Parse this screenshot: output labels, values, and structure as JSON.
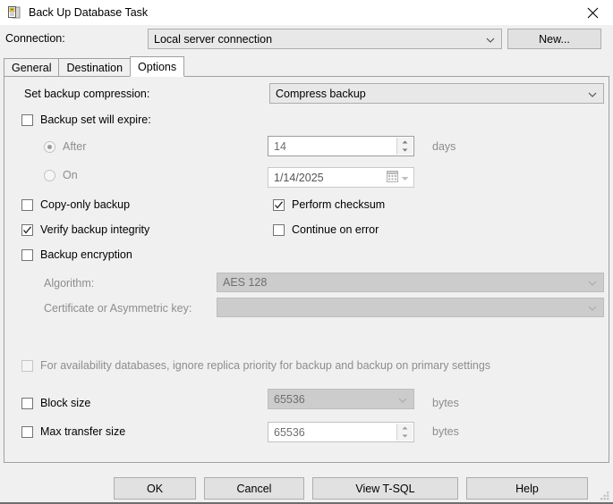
{
  "window": {
    "title": "Back Up Database Task",
    "icon": "backup-task-icon",
    "close_label": "✕"
  },
  "connection": {
    "label": "Connection:",
    "value": "Local server connection",
    "new_button": "New..."
  },
  "tabs": [
    {
      "label": "General",
      "active": false
    },
    {
      "label": "Destination",
      "active": false
    },
    {
      "label": "Options",
      "active": true
    }
  ],
  "options": {
    "compression": {
      "label": "Set backup compression:",
      "value": "Compress backup"
    },
    "backup_set_expire": {
      "label": "Backup set will expire:",
      "checked": false
    },
    "after": {
      "label": "After",
      "selected": true,
      "value": "14",
      "units": "days"
    },
    "on": {
      "label": "On",
      "selected": false,
      "value": "1/14/2025"
    },
    "copy_only_backup": {
      "label": "Copy-only backup",
      "checked": false
    },
    "perform_checksum": {
      "label": "Perform checksum",
      "checked": true
    },
    "verify_backup_integrity": {
      "label": "Verify backup integrity",
      "checked": true
    },
    "continue_on_error": {
      "label": "Continue on error",
      "checked": false
    },
    "backup_encryption": {
      "label": "Backup encryption",
      "checked": false
    },
    "algorithm": {
      "label": "Algorithm:",
      "value": "AES 128"
    },
    "certificate": {
      "label": "Certificate or Asymmetric key:",
      "value": ""
    },
    "availability": {
      "label": "For availability databases, ignore replica priority for backup and backup on primary settings",
      "checked": false
    },
    "block_size": {
      "label": "Block size",
      "checked": false,
      "value": "65536",
      "units": "bytes"
    },
    "max_transfer_size": {
      "label": "Max transfer size",
      "checked": false,
      "value": "65536",
      "units": "bytes"
    }
  },
  "buttons": {
    "ok": "OK",
    "cancel": "Cancel",
    "view_tsql": "View T-SQL",
    "help": "Help"
  },
  "colors": {
    "dialog_bg": "#f0f0f0",
    "titlebar_bg": "#ffffff",
    "button_face": "#e1e1e1",
    "disabled_text": "#8d8d8d",
    "border": "#a0a0a0"
  }
}
